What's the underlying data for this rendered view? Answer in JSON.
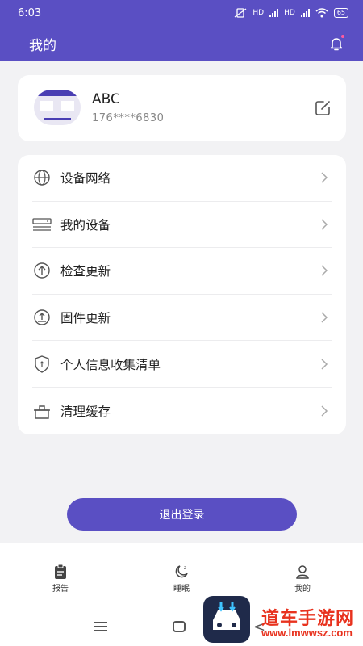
{
  "status_bar": {
    "time": "6:03",
    "network_1": "HD",
    "network_2": "HD",
    "battery": "65"
  },
  "header": {
    "title": "我的",
    "bell_icon": "bell-icon"
  },
  "profile": {
    "name": "ABC",
    "phone": "176****6830",
    "edit_icon": "edit-icon"
  },
  "menu": {
    "items": [
      {
        "label": "设备网络",
        "icon": "globe-icon"
      },
      {
        "label": "我的设备",
        "icon": "device-icon"
      },
      {
        "label": "检查更新",
        "icon": "upload-circle-icon"
      },
      {
        "label": "固件更新",
        "icon": "firmware-icon"
      },
      {
        "label": "个人信息收集清单",
        "icon": "shield-icon"
      },
      {
        "label": "清理缓存",
        "icon": "broom-icon"
      }
    ]
  },
  "logout_label": "退出登录",
  "tabs": [
    {
      "label": "报告",
      "icon": "clipboard-icon"
    },
    {
      "label": "睡眠",
      "icon": "moon-icon"
    },
    {
      "label": "我的",
      "icon": "person-icon"
    }
  ],
  "watermark": {
    "text": "道车手游网",
    "url": "www.lmwwsz.com"
  },
  "colors": {
    "primary": "#5a4fc3",
    "background": "#f2f2f4",
    "card": "#ffffff"
  }
}
